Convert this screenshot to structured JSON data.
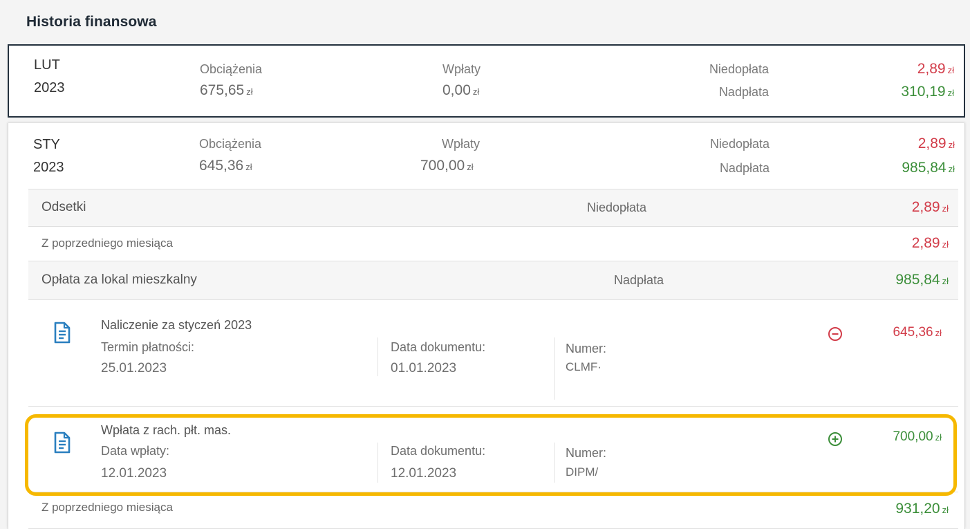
{
  "page": {
    "title": "Historia finansowa"
  },
  "months": [
    {
      "month": "LUT",
      "year": "2023",
      "charges_label": "Obciążenia",
      "charges_value": "675,65",
      "currency": "zł",
      "payments_label": "Wpłaty",
      "payments_value": "0,00",
      "underpay_label": "Niedopłata",
      "underpay_value": "2,89",
      "overpay_label": "Nadpłata",
      "overpay_value": "310,19"
    },
    {
      "month": "STY",
      "year": "2023",
      "charges_label": "Obciążenia",
      "charges_value": "645,36",
      "currency": "zł",
      "payments_label": "Wpłaty",
      "payments_value": "700,00",
      "underpay_label": "Niedopłata",
      "underpay_value": "2,89",
      "overpay_label": "Nadpłata",
      "overpay_value": "985,84"
    }
  ],
  "details": {
    "interest": {
      "label": "Odsetki",
      "status": "Niedopłata",
      "value": "2,89"
    },
    "interest_prev": {
      "label": "Z poprzedniego miesiąca",
      "value": "2,89"
    },
    "housing": {
      "label": "Opłata za lokal mieszkalny",
      "status": "Nadpłata",
      "value": "985,84"
    },
    "documents": [
      {
        "title": "Naliczenie za styczeń 2023",
        "date_label": "Termin płatności:",
        "date_value": "25.01.2023",
        "doc_date_label": "Data dokumentu:",
        "doc_date_value": "01.01.2023",
        "number_label": "Numer:",
        "number_value": "CLMF·",
        "sign_icon": "minus-circle-icon",
        "amount": "645,36"
      },
      {
        "title": "Wpłata z rach. płt. mas.",
        "date_label": "Data wpłaty:",
        "date_value": "12.01.2023",
        "doc_date_label": "Data dokumentu:",
        "doc_date_value": "12.01.2023",
        "number_label": "Numer:",
        "number_value": "DIPM/",
        "sign_icon": "plus-circle-icon",
        "amount": "700,00"
      }
    ],
    "housing_prev": {
      "label": "Z poprzedniego miesiąca",
      "value": "931,20"
    }
  },
  "colors": {
    "negative": "#d23c49",
    "positive": "#3b8e39",
    "icon": "#2a7fbf",
    "highlight": "#f6b800",
    "active_border": "#24313e"
  }
}
